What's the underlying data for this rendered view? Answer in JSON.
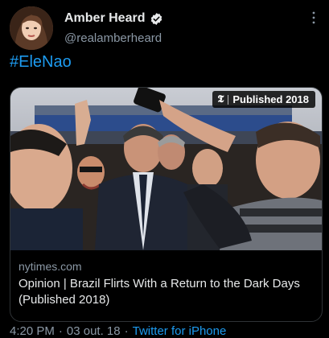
{
  "author": {
    "name": "Amber Heard",
    "handle": "@realamberheard",
    "verified": true
  },
  "tweet": {
    "text": "#EleNao"
  },
  "card": {
    "badge_text": "Published 2018",
    "domain": "nytimes.com",
    "title": "Opinion | Brazil Flirts With a Return to the Dark Days (Published 2018)"
  },
  "meta": {
    "time": "4:20 PM",
    "date": "03 out. 18",
    "separator": "·",
    "source": "Twitter for iPhone"
  },
  "icons": {
    "verified": "verified-badge-icon",
    "more": "more-options-icon",
    "nyt": "nyt-logo-icon"
  },
  "colors": {
    "background": "#000000",
    "link": "#1d9bf0",
    "secondary_text": "#8b98a5",
    "primary_text": "#e7e9ea"
  }
}
